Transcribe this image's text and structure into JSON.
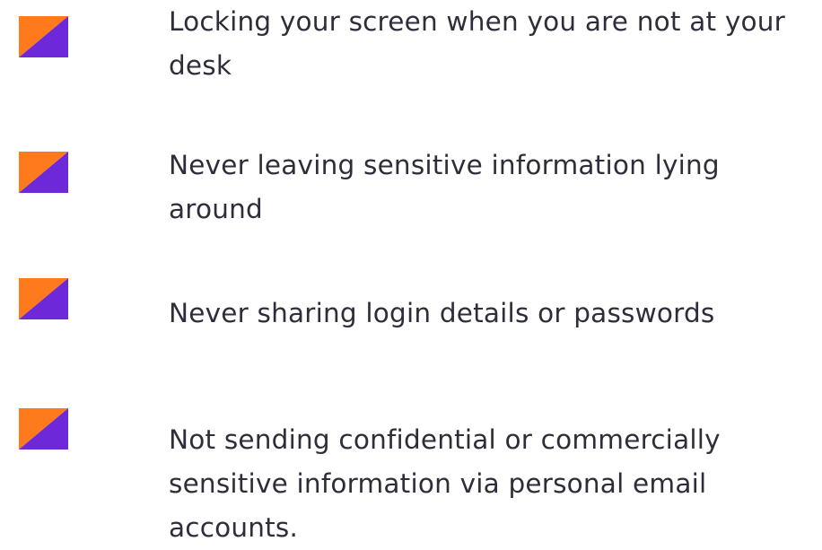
{
  "colors": {
    "marker_orange": "#ff7a1c",
    "marker_purple": "#6d28d9",
    "text": "#2e2e3a",
    "background": "#ffffff"
  },
  "items": [
    {
      "icon": "orange-purple-triangle-icon",
      "text": "Locking your screen when you are not at your desk"
    },
    {
      "icon": "orange-purple-triangle-icon",
      "text": "Never leaving sensitive information lying around"
    },
    {
      "icon": "orange-purple-triangle-icon",
      "text": "Never sharing login details or passwords"
    },
    {
      "icon": "orange-purple-triangle-icon",
      "text": "Not sending confidential or commercially sensitive information via personal email accounts."
    }
  ]
}
